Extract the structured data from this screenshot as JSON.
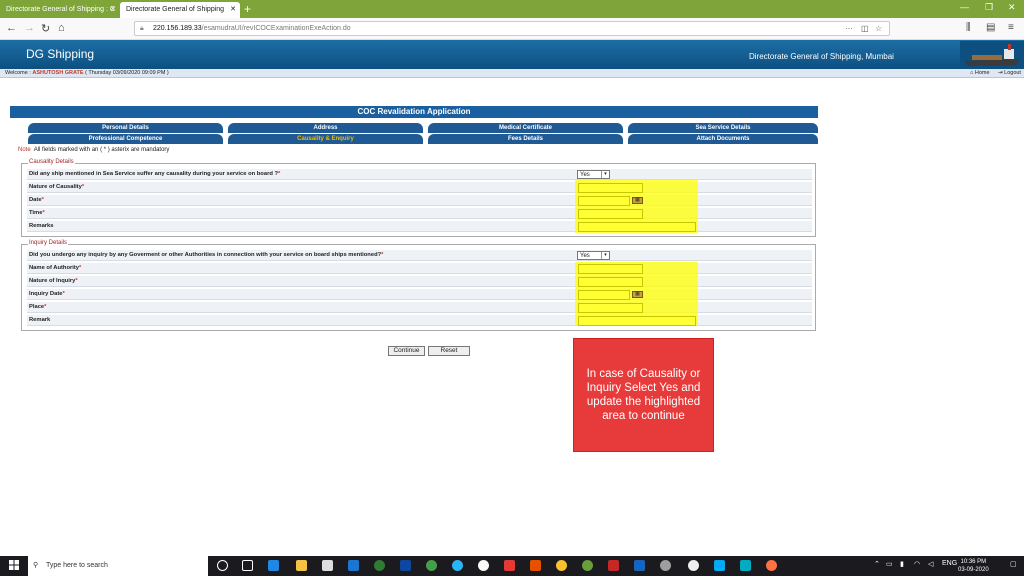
{
  "browser": {
    "tabs": [
      {
        "title": "Directorate General of Shipping : C"
      },
      {
        "title": "Directorate General of Shipping"
      }
    ],
    "url_host": "220.156.189.33",
    "url_path": "/esamudraUI/revICOCExaminationExeAction.do"
  },
  "site": {
    "logo": "DG Shipping",
    "org_title": "Directorate General of Shipping, Mumbai",
    "welcome_label": "Welcome :",
    "user_name": "ASHUTOSH GRATE",
    "date_text": "( Thursday 03/09/2020 09:09 PM )",
    "home_label": "Home",
    "logout_label": "Logout"
  },
  "form": {
    "title": "COC Revalidation Application",
    "tabs_row1": [
      "Personal Details",
      "Address",
      "Medical Certificate",
      "Sea Service Details"
    ],
    "tabs_row2": [
      "Professional Competence",
      "Causality & Enquiry",
      "Fees Details",
      "Attach Documents"
    ],
    "active_tab": "Causality & Enquiry",
    "note_label": "Note",
    "note_text": "All fields marked with an ( * ) asterix are mandatory",
    "causality": {
      "legend": "Causality Details",
      "question": "Did any ship mentioned in Sea Service suffer any causality during your service on board ?",
      "answer": "Yes",
      "fields": [
        {
          "label": "Nature of Causality",
          "required": true
        },
        {
          "label": "Date",
          "required": true
        },
        {
          "label": "Time",
          "required": true
        },
        {
          "label": "Remarks",
          "required": false
        }
      ]
    },
    "inquiry": {
      "legend": "Inquiry Details",
      "question": "Did you undergo any inquiry by any Goverment or other Authorities in connection with your service on board ships mentioned?",
      "answer": "Yes",
      "fields": [
        {
          "label": "Name of Authority",
          "required": true
        },
        {
          "label": "Nature of Inquiry",
          "required": true
        },
        {
          "label": "Inquiry Date",
          "required": true
        },
        {
          "label": "Place",
          "required": true
        },
        {
          "label": "Remark",
          "required": false
        }
      ]
    },
    "continue_label": "Continue",
    "reset_label": "Reset"
  },
  "callout": {
    "text": "In case of Causality or Inquiry Select Yes and update the highlighted area to continue"
  },
  "taskbar": {
    "search_placeholder": "Type here to search",
    "time": "10:36 PM",
    "date": "03-09-2020",
    "lang": "ENG"
  },
  "colors": {
    "accent_blue": "#1a5fa0",
    "highlight_yellow": "#ffff00",
    "callout_red": "#e73a3a",
    "browser_green": "#7fa53a"
  }
}
